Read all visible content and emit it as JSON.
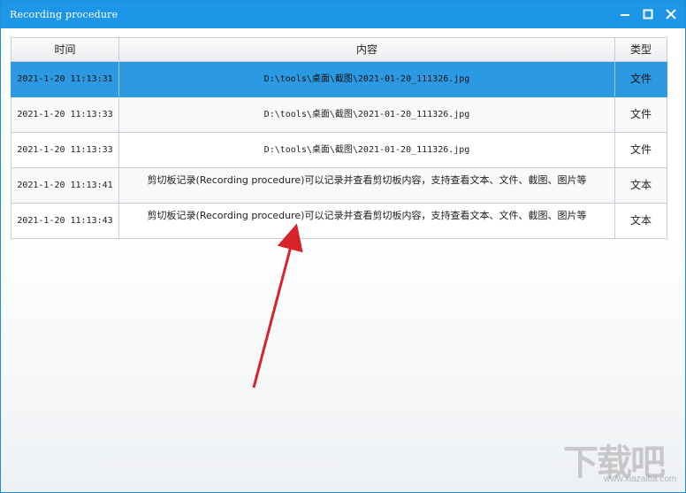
{
  "window": {
    "title": "Recording procedure"
  },
  "table": {
    "columns": [
      "时间",
      "内容",
      "类型"
    ],
    "rows": [
      {
        "time": "2021-1-20 11:13:31",
        "content": "D:\\tools\\桌面\\截图\\2021-01-20_111326.jpg",
        "type": "文件",
        "selected": true
      },
      {
        "time": "2021-1-20 11:13:33",
        "content": "D:\\tools\\桌面\\截图\\2021-01-20_111326.jpg",
        "type": "文件"
      },
      {
        "time": "2021-1-20 11:13:33",
        "content": "D:\\tools\\桌面\\截图\\2021-01-20_111326.jpg",
        "type": "文件"
      },
      {
        "time": "2021-1-20 11:13:41",
        "content": "剪切板记录(Recording procedure)可以记录并查看剪切板内容，支持查看文本、文件、截图、图片等",
        "type": "文本"
      },
      {
        "time": "2021-1-20 11:13:43",
        "content": "剪切板记录(Recording procedure)可以记录并查看剪切板内容，支持查看文本、文件、截图、图片等",
        "type": "文本"
      }
    ]
  },
  "annotation": {
    "arrow_color": "#d8232a"
  },
  "watermark": {
    "logo": "下载吧",
    "url": "www.xiazaiba.com"
  }
}
